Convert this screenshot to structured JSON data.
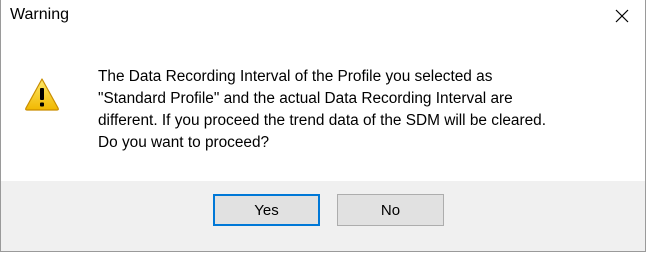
{
  "window": {
    "title": "Warning"
  },
  "icons": {
    "warning": "warning-triangle-icon",
    "close": "close-icon"
  },
  "message": {
    "lines": [
      "The Data Recording Interval of the Profile you selected as",
      "\"Standard Profile\" and the actual Data Recording Interval are",
      "different. If you proceed the trend data of the SDM will be cleared.",
      "Do you want to proceed?"
    ]
  },
  "buttons": {
    "yes_label": "Yes",
    "no_label": "No"
  },
  "colors": {
    "focus_border": "#0078d7",
    "warning_fill": "#f7c600",
    "button_bg": "#e1e1e1",
    "footer_bg": "#f0f0f0"
  }
}
